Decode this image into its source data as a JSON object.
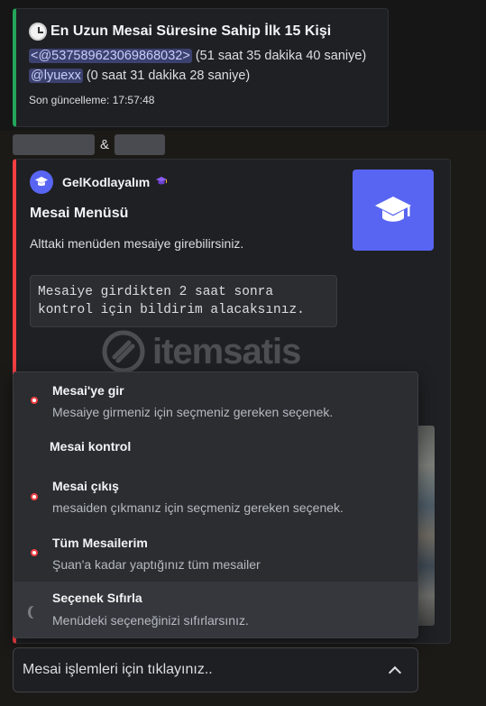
{
  "embed1": {
    "title": "En Uzun Mesai Süresine Sahip İlk 15 Kişi",
    "entries": [
      {
        "mention": "<@537589623069868032>",
        "detail": " (51 saat 35 dakika 40 saniye)"
      },
      {
        "mention": "@lyuexx",
        "detail": " (0 saat 31 dakika 28 saniye)"
      }
    ],
    "footer": "Son güncelleme: 17:57:48",
    "accent": "#23a55a"
  },
  "between": {
    "separator": "&"
  },
  "embed2": {
    "author": "GelKodlayalım",
    "title": "Mesai Menüsü",
    "description": "Alttaki menüden mesaiye girebilirsiniz.",
    "code_line1": "Mesaiye girdikten 2 saat sonra",
    "code_line2": "kontrol için bildirim alacaksınız.",
    "accent": "#f23f43",
    "thumbnail_icon": "graduation-cap-icon"
  },
  "watermark": {
    "text": "itemsatis"
  },
  "menu": {
    "options": [
      {
        "label": "Mesai'ye gir",
        "description": "Mesaiye girmeniz için seçmeniz gereken seçenek.",
        "icon": "red-dot-icon"
      },
      {
        "label": "Mesai kontrol",
        "description": "",
        "icon": ""
      },
      {
        "label": "Mesai çıkış",
        "description": "mesaiden çıkmanız için seçmeniz gereken seçenek.",
        "icon": "red-dot-icon"
      },
      {
        "label": "Tüm Mesailerim",
        "description": "Şuan'a kadar yaptığınız tüm mesailer",
        "icon": "red-dot-icon"
      },
      {
        "label": "Seçenek Sıfırla",
        "description": "Menüdeki seçeneğinizi sıfırlarsınız.",
        "icon": "moon-icon"
      }
    ]
  },
  "select": {
    "placeholder": "Mesai işlemleri için tıklayınız.."
  }
}
